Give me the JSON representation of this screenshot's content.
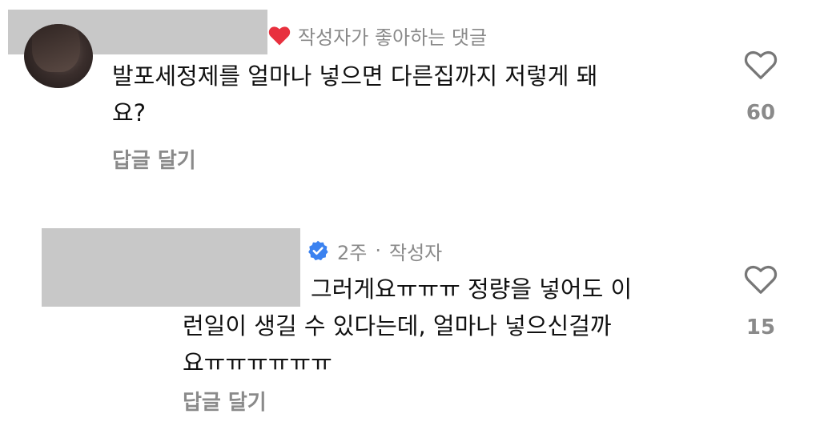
{
  "comment1": {
    "author_liked_label": "작성자가 좋아하는 댓글",
    "text_line1": "발포세정제를 얼마나 넣으면 다른집까지 저렇게 돼",
    "text_line2": "요?",
    "reply_label": "답글 달기",
    "like_count": "60"
  },
  "comment2": {
    "time": "2주",
    "separator": "·",
    "author_tag": "작성자",
    "text_line1": "그러게요ㅠㅠㅠ 정량을 넣어도 이",
    "text_line2": "런일이 생길 수 있다는데, 얼마나 넣으신걸까",
    "text_line3": "요ㅠㅠㅠㅠㅠㅠ",
    "reply_label": "답글 달기",
    "like_count": "15"
  },
  "colors": {
    "liked_heart": "#e8303e",
    "verified_badge": "#3b82f0",
    "muted_text": "#8a8a8a",
    "redaction": "#c8c8c8"
  },
  "icons": [
    "heart-icon",
    "verified-badge-icon",
    "heart-outline-icon"
  ]
}
